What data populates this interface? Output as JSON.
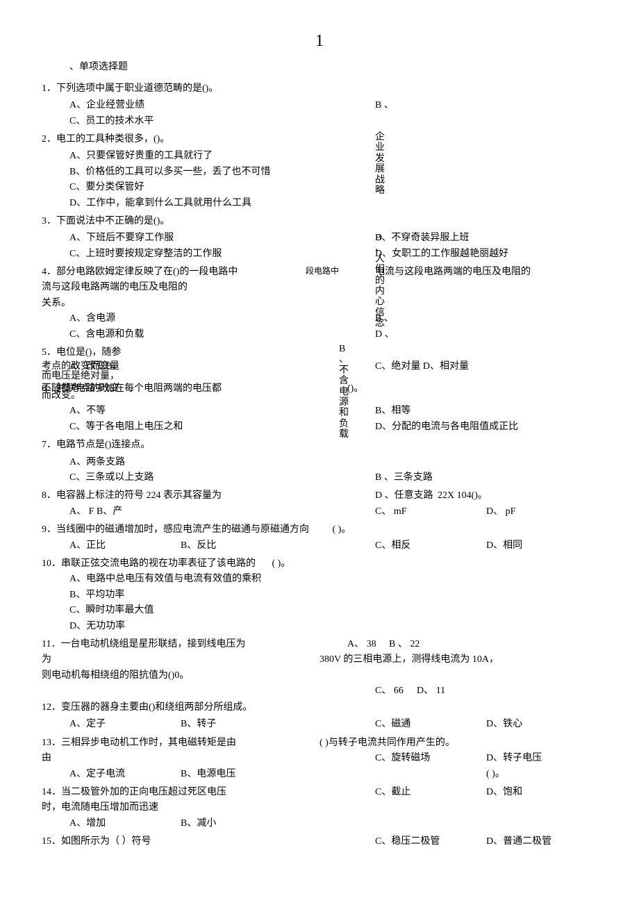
{
  "pageNumber": "1",
  "sectionTitle": "、单项选择题",
  "q1": {
    "text": "1．下列选项中属于职业道德范畴的是()。",
    "a": "A、企业经营业绩",
    "b_label": "B 、",
    "b_text": "企业发展战略",
    "c": "C、员工的技术水平",
    "d_label": "D 、",
    "d_text": "人们的内心信念"
  },
  "q2": {
    "text": "2．电工的工具种类很多，()。",
    "a": "A、只要保管好贵重的工具就行了",
    "b": "B、价格低的工具可以多买一些，丢了也不可惜",
    "c": "C、要分类保管好",
    "d": "D、工作中，能拿到什么工具就用什么工具"
  },
  "q3": {
    "text": "3．下面说法中不正确的是()。",
    "a": "A、下班后不要穿工作服",
    "b": "B、不穿奇装异服上班",
    "c": "C、上班时要按规定穿整洁的工作服",
    "d": "D、女职工的工作服越艳丽越好"
  },
  "q4": {
    "text1": "4．部分电路欧姆定律反映了在()的一段电路中",
    "text_mid": "段电路中",
    "text_right": "电流与这段电路两端的电压及电阻的",
    "text2": "流与这段电路两端的电压及电阻的",
    "text3": "关系。",
    "a": "A、含电源",
    "b": "B 、不含电源和负载",
    "c": "C、含电源和负载",
    "d": "D 、"
  },
  "q5": {
    "text": "5．电位是()，随参",
    "line2a": "考点的改变而变量",
    "line2b": "A、改变B、",
    "line3": "而电压是绝对量，",
    "line4": "不随参考点的改变",
    "line5": "而改变。",
    "c": "C、绝对量 D、相对量"
  },
  "q6": {
    "text": "6．并联电路中加在每个电阻两端的电压都",
    "blank": "()。",
    "a": "A、不等",
    "b": "B、相等",
    "c": "C、等于各电阻上电压之和",
    "d": "D、分配的电流与各电阻值成正比"
  },
  "q7": {
    "text": "7．电路节点是()连接点。",
    "a": "A、两条支路",
    "b": "B 、三条支路",
    "c": "C、三条或以上支路",
    "d": "D 、任意支路"
  },
  "q8": {
    "text": "8．电容器上标注的符号 224 表示其容量为",
    "suffix": "22X 104()。",
    "a": "A、 F",
    "b": "B、产",
    "c": "C、 mF",
    "d": "D、 pF"
  },
  "q9": {
    "text": "9．当线圈中的磁通增加时，感应电流产生的磁通与原磁通方向",
    "blank": "(      )。",
    "a": "A、正比",
    "b": "B、反比",
    "c": "C、相反",
    "d": "D、相同"
  },
  "q10": {
    "text": "10．串联正弦交流电路的视在功率表征了该电路的",
    "blank": "(     )。",
    "a": "A、电路中总电压有效值与电流有效值的乘积",
    "b": "B、平均功率",
    "c": "C、瞬时功率最大值",
    "d": "D、无功功率"
  },
  "q11": {
    "text1": "11．一台电动机绕组是星形联结，接到线电压为",
    "text2": "380V 的三相电源上，测得线电流为 10A，",
    "text3": "则电动机每相绕组的阻抗值为()0。",
    "a": "A、 38",
    "b": "B 、 22",
    "c": "C、 66",
    "d": "D、 11"
  },
  "q12": {
    "text": "12．变压器的器身主要由()和绕组两部分所组成。",
    "a": "A、定子",
    "b": "B、转子",
    "c": "C、磁通",
    "d": "D、铁心"
  },
  "q13": {
    "text": "13．三相异步电动机工作时，其电磁转矩是由",
    "blank": "(     )与转子电流共同作用产生的。",
    "a": "A、定子电流",
    "b": "B、电源电压",
    "c": "C、旋转磁场",
    "d": "D、转子电压"
  },
  "q14": {
    "text": "14．当二极管外加的正向电压超过死区电压时，电流随电压增加而迅速",
    "blank": "(     )。",
    "a": "A、增加",
    "b": "B、减小",
    "c": "C、截止",
    "d": "D、饱和"
  },
  "q15": {
    "text": "15．如图所示为（   ）符号",
    "c": "C、稳压二极管",
    "d": "D、普通二极管"
  }
}
